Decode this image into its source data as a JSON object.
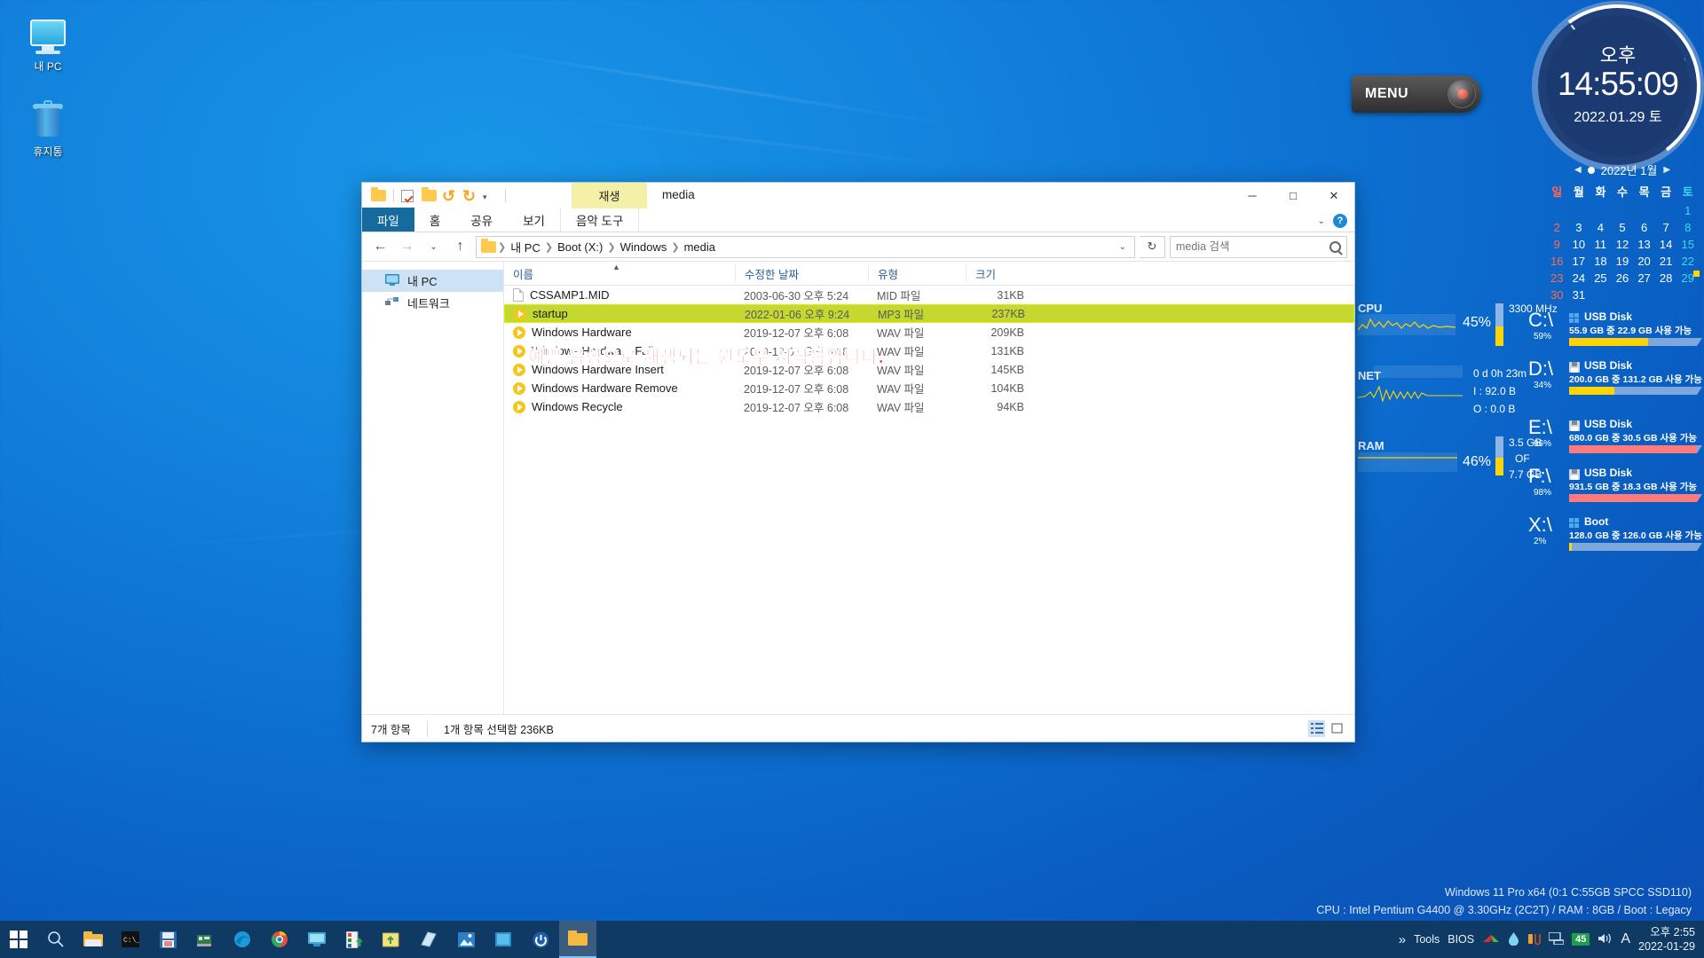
{
  "desktop": {
    "icons": [
      {
        "label": "내 PC",
        "icon": "monitor-icon"
      },
      {
        "label": "휴지통",
        "icon": "recycle-bin-icon"
      }
    ],
    "menu_pill": {
      "label": "MENU",
      "icon": "menu-knob-icon"
    },
    "system_info": {
      "line1": "Windows 11 Pro x64 (0:1 C:55GB SPCC SSD110)",
      "line2": "CPU : Intel Pentium G4400 @ 3.30GHz (2C2T) / RAM : 8GB / Boot : Legacy"
    }
  },
  "clock": {
    "ampm": "오후",
    "time": "14:55:09",
    "date": "2022.01.29 토"
  },
  "calendar": {
    "title": "2022년 1월",
    "prev": "◀",
    "next": "▶",
    "dow": [
      "일",
      "월",
      "화",
      "수",
      "목",
      "금",
      "토"
    ],
    "weeks": [
      [
        "",
        "",
        "",
        "",
        "",
        "",
        "1"
      ],
      [
        "2",
        "3",
        "4",
        "5",
        "6",
        "7",
        "8"
      ],
      [
        "9",
        "10",
        "11",
        "12",
        "13",
        "14",
        "15"
      ],
      [
        "16",
        "17",
        "18",
        "19",
        "20",
        "21",
        "22"
      ],
      [
        "23",
        "24",
        "25",
        "26",
        "27",
        "28",
        "29"
      ],
      [
        "30",
        "31",
        "",
        "",
        "",
        "",
        ""
      ]
    ],
    "today": "29"
  },
  "sysmon": {
    "cpu": {
      "label": "CPU",
      "pct": "45%",
      "freq": "3300 MHz",
      "fill": 45
    },
    "net": {
      "label": "NET",
      "uptime": "0 d 0h 23m",
      "in": "I : 92.0 B",
      "out": "O : 0.0 B"
    },
    "ram": {
      "label": "RAM",
      "pct": "46%",
      "used": "3.5 GB",
      "of": "OF",
      "total": "7.7 GB",
      "fill": 46
    }
  },
  "drives": [
    {
      "letter": "C:\\",
      "pct": "59%",
      "fill": 59,
      "name": "USB Disk",
      "detail": "55.9 GB 중  22.9 GB 사용 가능",
      "color": "#ffd400",
      "icon": "windows-drive-icon"
    },
    {
      "letter": "D:\\",
      "pct": "34%",
      "fill": 34,
      "name": "USB Disk",
      "detail": "200.0 GB 중 131.2 GB 사용 가능",
      "color": "#ffd400",
      "icon": "floppy-drive-icon"
    },
    {
      "letter": "E:\\",
      "pct": "96%",
      "fill": 96,
      "name": "USB Disk",
      "detail": "680.0 GB 중 30.5 GB 사용 가능",
      "color": "#ff7b7b",
      "icon": "floppy-drive-icon"
    },
    {
      "letter": "F:\\",
      "pct": "98%",
      "fill": 98,
      "name": "USB Disk",
      "detail": "931.5 GB 중 18.3 GB 사용 가능",
      "color": "#ff7b7b",
      "icon": "floppy-drive-icon"
    },
    {
      "letter": "X:\\",
      "pct": "2%",
      "fill": 2,
      "name": "Boot",
      "detail": "128.0 GB 중 126.0 GB 사용 가능",
      "color": "#ffd400",
      "icon": "windows-drive-icon"
    }
  ],
  "explorer": {
    "title": "media",
    "play_tab": "재생",
    "ribbon_tabs": [
      "파일",
      "홈",
      "공유",
      "보기",
      "음악 도구"
    ],
    "window_controls": {
      "minimize": "─",
      "maximize": "□",
      "close": "✕"
    },
    "nav": {
      "back": "←",
      "forward": "→",
      "recent": "⌄",
      "up": "↑",
      "refresh": "↻"
    },
    "breadcrumb": [
      "내 PC",
      "Boot (X:)",
      "Windows",
      "media"
    ],
    "search_placeholder": "media 검색",
    "search_value": "",
    "nav_pane": [
      {
        "label": "내 PC",
        "icon": "pc-icon",
        "selected": true
      },
      {
        "label": "네트워크",
        "icon": "network-icon",
        "selected": false
      }
    ],
    "columns": [
      "이름",
      "수정한 날짜",
      "유형",
      "크기"
    ],
    "rows": [
      {
        "name": "CSSAMP1.MID",
        "date": "2003-06-30 오후 5:24",
        "type": "MID 파일",
        "size": "31KB",
        "icon": "document-icon",
        "selected": false
      },
      {
        "name": "startup",
        "date": "2022-01-06 오후 9:24",
        "type": "MP3 파일",
        "size": "237KB",
        "icon": "audio-icon",
        "selected": true
      },
      {
        "name": "Windows Hardware",
        "date": "2019-12-07 오후 6:08",
        "type": "WAV 파일",
        "size": "209KB",
        "icon": "audio-icon",
        "selected": false
      },
      {
        "name": "Windows Hardware Fail",
        "date": "2019-12-07 오후 6:08",
        "type": "WAV 파일",
        "size": "131KB",
        "icon": "audio-icon",
        "selected": false
      },
      {
        "name": "Windows Hardware Insert",
        "date": "2019-12-07 오후 6:08",
        "type": "WAV 파일",
        "size": "145KB",
        "icon": "audio-icon",
        "selected": false
      },
      {
        "name": "Windows Hardware Remove",
        "date": "2019-12-07 오후 6:08",
        "type": "WAV 파일",
        "size": "104KB",
        "icon": "audio-icon",
        "selected": false
      },
      {
        "name": "Windows Recycle",
        "date": "2019-12-07 오후 6:08",
        "type": "WAV 파일",
        "size": "94KB",
        "icon": "audio-icon",
        "selected": false
      }
    ],
    "annotation": "예쁜 음성으로 재생되는 윈도우 시작음입니다.",
    "status": {
      "count": "7개 항목",
      "selection": "1개 항목 선택함 236KB"
    }
  },
  "taskbar": {
    "start": "start-button",
    "items": [
      "search-icon",
      "file-explorer-icon",
      "command-prompt-icon",
      "save-icon",
      "network-card-icon",
      "edge-icon",
      "chrome-icon",
      "monitor-icon",
      "installer-icon",
      "upload-folder-icon",
      "notes-icon",
      "photos-icon",
      "display-icon",
      "power-icon",
      "explorer-window-icon"
    ],
    "tray": {
      "overflow": "»",
      "tools": "Tools",
      "bios": "BIOS",
      "battery_pct": "45",
      "ime": "A",
      "time": "오후 2:55",
      "date": "2022-01-29"
    }
  }
}
